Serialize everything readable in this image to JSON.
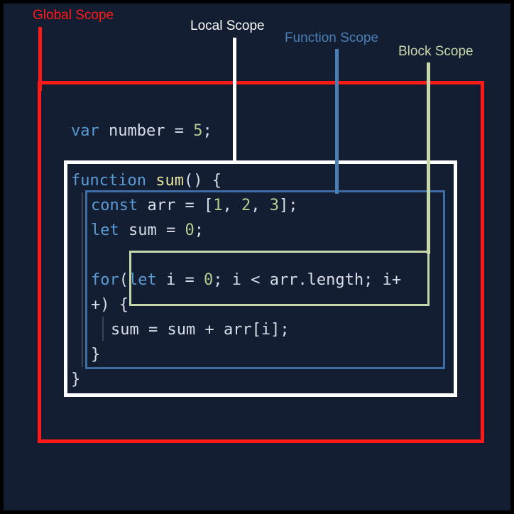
{
  "diagram": {
    "title": "JavaScript Scope Diagram",
    "background_color": "#141e32",
    "border_color": "#000000"
  },
  "labels": [
    {
      "id": "global",
      "text": "Global Scope",
      "color": "#ff1a18"
    },
    {
      "id": "local",
      "text": "Local Scope",
      "color": "#ffffff"
    },
    {
      "id": "function",
      "text": "Function Scope",
      "color": "#4a7fb5"
    },
    {
      "id": "block",
      "text": "Block Scope",
      "color": "#c6d7a9"
    }
  ],
  "boxes": [
    {
      "id": "global",
      "label": "Global Scope",
      "color": "#ff1a18"
    },
    {
      "id": "local",
      "label": "Local Scope",
      "color": "#ffffff"
    },
    {
      "id": "function",
      "label": "Function Scope",
      "color": "#3d6fa5"
    },
    {
      "id": "block",
      "label": "Block Scope",
      "color": "#c6d7a9"
    }
  ],
  "code": {
    "language": "javascript",
    "lines": [
      "var number = 5;",
      "function sum() {",
      "const arr = [1, 2, 3];",
      "let sum = 0;",
      "for(let i = 0; i < arr.length; i+",
      "+) {",
      "sum = sum + arr[i];",
      "}",
      "}"
    ],
    "tokens": {
      "l1_kw": "var",
      "l1_name": " number = ",
      "l1_num": "5",
      "l1_end": ";",
      "l2_kw": "function",
      "l2_fn": " sum",
      "l2_end": "() {",
      "l3_kw": "const",
      "l3_name": " arr = [",
      "l3_n1": "1",
      "l3_s1": ", ",
      "l3_n2": "2",
      "l3_s2": ", ",
      "l3_n3": "3",
      "l3_end": "];",
      "l4_kw": "let",
      "l4_name": " sum = ",
      "l4_num": "0",
      "l4_end": ";",
      "l5_kw": "for",
      "l5_p": "(",
      "l5_kw2": "let",
      "l5_a": " i = ",
      "l5_num": "0",
      "l5_b": "; i < arr.length; i+",
      "l6_text": "+) {",
      "l7_text": "sum = sum + arr[i];",
      "l8_text": "}",
      "l9_text": "}"
    },
    "colors": {
      "keyword": "#5a9bd5",
      "function_name": "#e6e6a0",
      "number": "#b5cc8e",
      "plain": "#d8dee9"
    }
  }
}
